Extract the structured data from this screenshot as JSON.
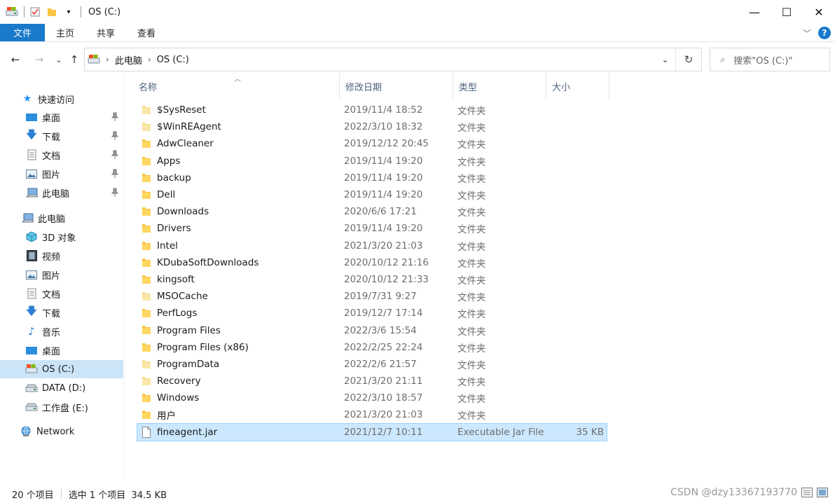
{
  "window": {
    "title": "OS (C:)",
    "minimize": "—",
    "maximize": "☐",
    "close": "✕"
  },
  "ribbon": {
    "tabs": [
      {
        "label": "文件",
        "active": true
      },
      {
        "label": "主页"
      },
      {
        "label": "共享"
      },
      {
        "label": "查看"
      }
    ],
    "expand": "﹀",
    "help": "?"
  },
  "nav": {
    "back": "←",
    "forward": "→",
    "recent": "⌄",
    "up": "↑",
    "breadcrumb": [
      "此电脑",
      "OS (C:)"
    ],
    "search_placeholder": "搜索\"OS (C:)\""
  },
  "sidebar": {
    "quick_access": "快速访问",
    "quick_items": [
      "桌面",
      "下载",
      "文档",
      "图片",
      "此电脑"
    ],
    "this_pc": "此电脑",
    "pc_items": [
      "3D 对象",
      "视频",
      "图片",
      "文档",
      "下载",
      "音乐",
      "桌面",
      "OS (C:)",
      "DATA (D:)",
      "工作盘 (E:)"
    ],
    "selected": "OS (C:)",
    "network": "Network"
  },
  "columns": {
    "name": "名称",
    "date": "修改日期",
    "type": "类型",
    "size": "大小"
  },
  "files": [
    {
      "name": "$SysReset",
      "date": "2019/11/4 18:52",
      "type": "文件夹",
      "size": "",
      "kind": "folder-light"
    },
    {
      "name": "$WinREAgent",
      "date": "2022/3/10 18:32",
      "type": "文件夹",
      "size": "",
      "kind": "folder-light"
    },
    {
      "name": "AdwCleaner",
      "date": "2019/12/12 20:45",
      "type": "文件夹",
      "size": "",
      "kind": "folder"
    },
    {
      "name": "Apps",
      "date": "2019/11/4 19:20",
      "type": "文件夹",
      "size": "",
      "kind": "folder"
    },
    {
      "name": "backup",
      "date": "2019/11/4 19:20",
      "type": "文件夹",
      "size": "",
      "kind": "folder"
    },
    {
      "name": "Dell",
      "date": "2019/11/4 19:20",
      "type": "文件夹",
      "size": "",
      "kind": "folder"
    },
    {
      "name": "Downloads",
      "date": "2020/6/6 17:21",
      "type": "文件夹",
      "size": "",
      "kind": "folder"
    },
    {
      "name": "Drivers",
      "date": "2019/11/4 19:20",
      "type": "文件夹",
      "size": "",
      "kind": "folder"
    },
    {
      "name": "Intel",
      "date": "2021/3/20 21:03",
      "type": "文件夹",
      "size": "",
      "kind": "folder"
    },
    {
      "name": "KDubaSoftDownloads",
      "date": "2020/10/12 21:16",
      "type": "文件夹",
      "size": "",
      "kind": "folder"
    },
    {
      "name": "kingsoft",
      "date": "2020/10/12 21:33",
      "type": "文件夹",
      "size": "",
      "kind": "folder"
    },
    {
      "name": "MSOCache",
      "date": "2019/7/31 9:27",
      "type": "文件夹",
      "size": "",
      "kind": "folder-light"
    },
    {
      "name": "PerfLogs",
      "date": "2019/12/7 17:14",
      "type": "文件夹",
      "size": "",
      "kind": "folder"
    },
    {
      "name": "Program Files",
      "date": "2022/3/6 15:54",
      "type": "文件夹",
      "size": "",
      "kind": "folder"
    },
    {
      "name": "Program Files (x86)",
      "date": "2022/2/25 22:24",
      "type": "文件夹",
      "size": "",
      "kind": "folder"
    },
    {
      "name": "ProgramData",
      "date": "2022/2/6 21:57",
      "type": "文件夹",
      "size": "",
      "kind": "folder-light"
    },
    {
      "name": "Recovery",
      "date": "2021/3/20 21:11",
      "type": "文件夹",
      "size": "",
      "kind": "folder-light"
    },
    {
      "name": "Windows",
      "date": "2022/3/10 18:57",
      "type": "文件夹",
      "size": "",
      "kind": "folder"
    },
    {
      "name": "用户",
      "date": "2021/3/20 21:03",
      "type": "文件夹",
      "size": "",
      "kind": "folder"
    },
    {
      "name": "fineagent.jar",
      "date": "2021/12/7 10:11",
      "type": "Executable Jar File",
      "size": "35 KB",
      "kind": "file",
      "selected": true
    }
  ],
  "status": {
    "count": "20 个项目",
    "selection": "选中 1 个项目  34.5 KB"
  },
  "watermark": "CSDN @dzy13367193770",
  "colors": {
    "accent": "#1979ca",
    "selection": "#cce8ff",
    "folder": "#f8c443"
  }
}
